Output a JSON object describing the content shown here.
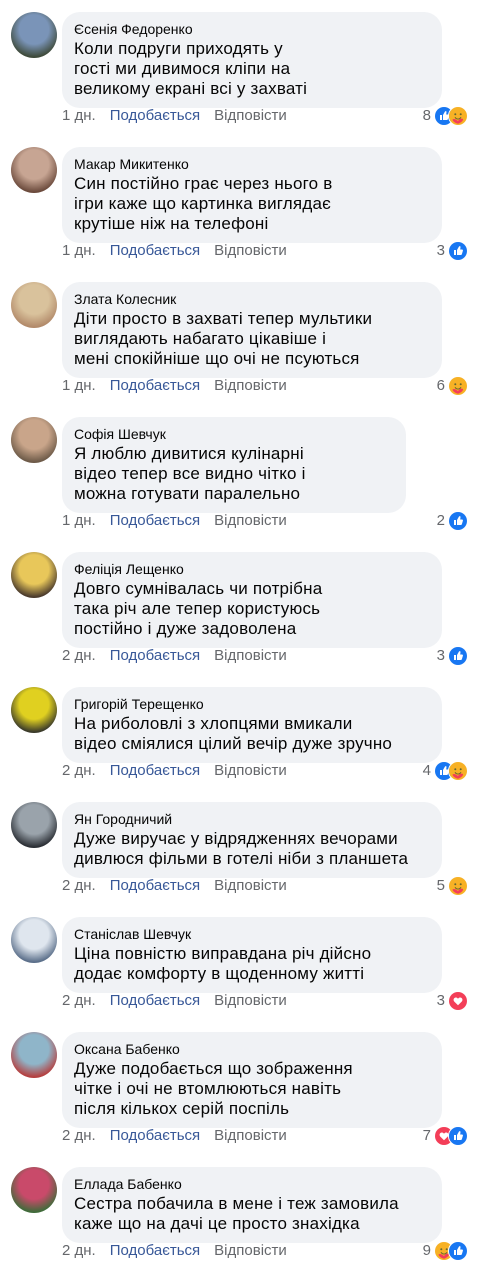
{
  "comments": [
    {
      "author": "Єсенія Федоренко",
      "lines": [
        "Коли подруги приходять у",
        "гості ми дивимося кліпи на",
        "великому екрані всі у захваті"
      ],
      "time": "1 дн.",
      "like": "Подобається",
      "reply": "Відповісти",
      "count": "8",
      "reactions": [
        "like",
        "care"
      ],
      "avatar_colors": [
        "#7a94b8",
        "#3e4a3a"
      ]
    },
    {
      "author": "Макар Микитенко",
      "lines": [
        "Син постійно грає через нього в",
        "ігри каже що картинка виглядає",
        "крутіше ніж на телефоні"
      ],
      "time": "1 дн.",
      "like": "Подобається",
      "reply": "Відповісти",
      "count": "3",
      "reactions": [
        "like"
      ],
      "avatar_colors": [
        "#c7a593",
        "#6b4a3c"
      ]
    },
    {
      "author": "Злата Колесник",
      "lines": [
        "Діти просто в захваті тепер мультики",
        "виглядають набагато цікавіше і",
        "мені спокійніше що очі не псуються"
      ],
      "time": "1 дн.",
      "like": "Подобається",
      "reply": "Відповісти",
      "count": "6",
      "reactions": [
        "care"
      ],
      "avatar_colors": [
        "#d9c29c",
        "#b28a6a"
      ]
    },
    {
      "author": "Софія Шевчук",
      "lines": [
        "Я люблю дивитися кулінарні",
        "відео тепер все видно чітко і",
        "можна готувати паралельно"
      ],
      "time": "1 дн.",
      "like": "Подобається",
      "reply": "Відповісти",
      "count": "2",
      "reactions": [
        "like"
      ],
      "avatar_colors": [
        "#c9a58a",
        "#6d5a48"
      ]
    },
    {
      "author": "Феліція Лещенко",
      "lines": [
        "Довго сумнівалась чи потрібна",
        "така річ але тепер користуюсь",
        "постійно і дуже задоволена"
      ],
      "time": "2 дн.",
      "like": "Подобається",
      "reply": "Відповісти",
      "count": "3",
      "reactions": [
        "like"
      ],
      "avatar_colors": [
        "#e8c75a",
        "#4a3a2c"
      ]
    },
    {
      "author": "Григорій Терещенко",
      "lines": [
        "На риболовлі з хлопцями вмикали",
        "відео сміялися цілий вечір дуже зручно"
      ],
      "time": "2 дн.",
      "like": "Подобається",
      "reply": "Відповісти",
      "count": "4",
      "reactions": [
        "like",
        "care"
      ],
      "avatar_colors": [
        "#e0d020",
        "#3a3a2a"
      ]
    },
    {
      "author": "Ян Городничий",
      "lines": [
        "Дуже виручає у відрядженнях вечорами",
        "дивлюся фільми в готелі ніби з планшета"
      ],
      "time": "2 дн.",
      "like": "Подобається",
      "reply": "Відповісти",
      "count": "5",
      "reactions": [
        "care"
      ],
      "avatar_colors": [
        "#9aa3ab",
        "#2b2f35"
      ]
    },
    {
      "author": "Станіслав Шевчук",
      "lines": [
        "Ціна повністю виправдана річ дійсно",
        "додає комфорту в щоденному житті"
      ],
      "time": "2 дн.",
      "like": "Подобається",
      "reply": "Відповісти",
      "count": "3",
      "reactions": [
        "love"
      ],
      "avatar_colors": [
        "#dfe6ee",
        "#5b6f8a"
      ]
    },
    {
      "author": "Оксана Бабенко",
      "lines": [
        "Дуже подобається що зображення",
        "чітке і очі не втомлюються навіть",
        "після кількох серій поспіль"
      ],
      "time": "2 дн.",
      "like": "Подобається",
      "reply": "Відповісти",
      "count": "7",
      "reactions": [
        "love",
        "like"
      ],
      "avatar_colors": [
        "#8fb5c9",
        "#b53f3f"
      ]
    },
    {
      "author": "Еллада Бабенко",
      "lines": [
        "Сестра побачила в мене і теж замовила",
        "каже що на дачі це просто знахідка"
      ],
      "time": "2 дн.",
      "like": "Подобається",
      "reply": "Відповісти",
      "count": "9",
      "reactions": [
        "care",
        "like"
      ],
      "avatar_colors": [
        "#c94a6a",
        "#3f6b3a"
      ]
    }
  ]
}
